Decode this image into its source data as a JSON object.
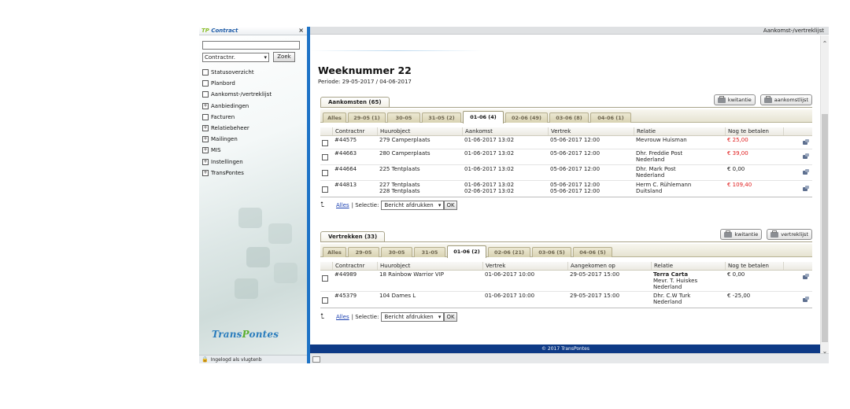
{
  "sidebar": {
    "brand_tp": "TP",
    "brand_contract": "Contract",
    "close": "×",
    "search_value": "",
    "select_value": "Contractnr.",
    "zoek": "Zoek",
    "items": [
      {
        "label": "Statusoverzicht",
        "expandable": false
      },
      {
        "label": "Planbord",
        "expandable": false
      },
      {
        "label": "Aankomst-/vertreklijst",
        "expandable": false
      },
      {
        "label": "Aanbiedingen",
        "expandable": true
      },
      {
        "label": "Facturen",
        "expandable": false
      },
      {
        "label": "Relatiebeheer",
        "expandable": true
      },
      {
        "label": "Mailingen",
        "expandable": true
      },
      {
        "label": "MIS",
        "expandable": true
      },
      {
        "label": "Instellingen",
        "expandable": true
      },
      {
        "label": "TransPontes",
        "expandable": true
      }
    ],
    "logo_a": "Trans",
    "logo_b": "P",
    "logo_c": "ontes",
    "footer": "Ingelogd als vlugtenb"
  },
  "topbar": {
    "title": "Aankomst-/vertreklijst"
  },
  "page": {
    "title": "Weeknummer 22",
    "periode": "Periode: 29-05-2017 / 04-06-2017"
  },
  "aankomsten": {
    "tab": "Aankomsten (65)",
    "btn_kwitantie": "kwitantie",
    "btn_list": "aankomstlijst",
    "date_tabs": [
      "Alles",
      "29-05 (1)",
      "30-05",
      "31-05 (2)",
      "01-06 (4)",
      "02-06 (49)",
      "03-06 (8)",
      "04-06 (1)"
    ],
    "active_tab": 4,
    "headers": [
      "Contractnr",
      "Huurobject",
      "Aankomst",
      "Vertrek",
      "Relatie",
      "Nog te betalen"
    ],
    "rows": [
      {
        "nr": "#44575",
        "obj1": "279 Camperplaats",
        "obj2": "",
        "a1": "01-06-2017 13:02",
        "a2": "",
        "v1": "05-06-2017 12:00",
        "v2": "",
        "r1": "Mevrouw Huisman",
        "r2": "",
        "amount": "€ 25,00",
        "red": true
      },
      {
        "nr": "#44663",
        "obj1": "280 Camperplaats",
        "obj2": "",
        "a1": "01-06-2017 13:02",
        "a2": "",
        "v1": "05-06-2017 12:00",
        "v2": "",
        "r1": "Dhr. Freddie Post",
        "r2": "Nederland",
        "amount": "€ 39,00",
        "red": true
      },
      {
        "nr": "#44664",
        "obj1": "225 Tentplaats",
        "obj2": "",
        "a1": "01-06-2017 13:02",
        "a2": "",
        "v1": "05-06-2017 12:00",
        "v2": "",
        "r1": "Dhr. Mark Post",
        "r2": "Nederland",
        "amount": "€ 0,00",
        "red": false
      },
      {
        "nr": "#44813",
        "obj1": "227 Tentplaats",
        "obj2": "228 Tentplaats",
        "a1": "01-06-2017 13:02",
        "a2": "02-06-2017 13:02",
        "v1": "05-06-2017 12:00",
        "v2": "05-06-2017 12:00",
        "r1": "Herm C. Rühlemann",
        "r2": "Duitsland",
        "amount": "€ 109,40",
        "red": true
      }
    ]
  },
  "vertrekken": {
    "tab": "Vertrekken (33)",
    "btn_kwitantie": "kwitantie",
    "btn_list": "vertreklijst",
    "date_tabs": [
      "Alles",
      "29-05",
      "30-05",
      "31-05",
      "01-06 (2)",
      "02-06 (21)",
      "03-06 (5)",
      "04-06 (5)"
    ],
    "active_tab": 4,
    "headers": [
      "Contractnr",
      "Huurobject",
      "Vertrek",
      "Aangekomen op",
      "Relatie",
      "Nog te betalen"
    ],
    "rows": [
      {
        "nr": "#44989",
        "obj1": "18 Rainbow Warrior VIP",
        "v1": "01-06-2017 10:00",
        "a1": "29-05-2017 15:00",
        "r1": "Terra Carta",
        "r2": "Mevr. T. Huiskes",
        "r3": "Nederland",
        "amount": "€ 0,00"
      },
      {
        "nr": "#45379",
        "obj1": "104 Dames L",
        "v1": "01-06-2017 10:00",
        "a1": "29-05-2017 15:00",
        "r1": "Dhr. C.W Turk",
        "r2": "Nederland",
        "r3": "",
        "amount": "€ -25,00"
      }
    ]
  },
  "selectie": {
    "alles": "Alles",
    "label": "| Selectie:",
    "value": "Bericht afdrukken",
    "ok": "OK"
  },
  "footer": {
    "text": "© 2017 TransPontes"
  },
  "colors": {
    "accent": "#1e73c6",
    "footer": "#0e3a86",
    "negative": "#e01b1b"
  }
}
